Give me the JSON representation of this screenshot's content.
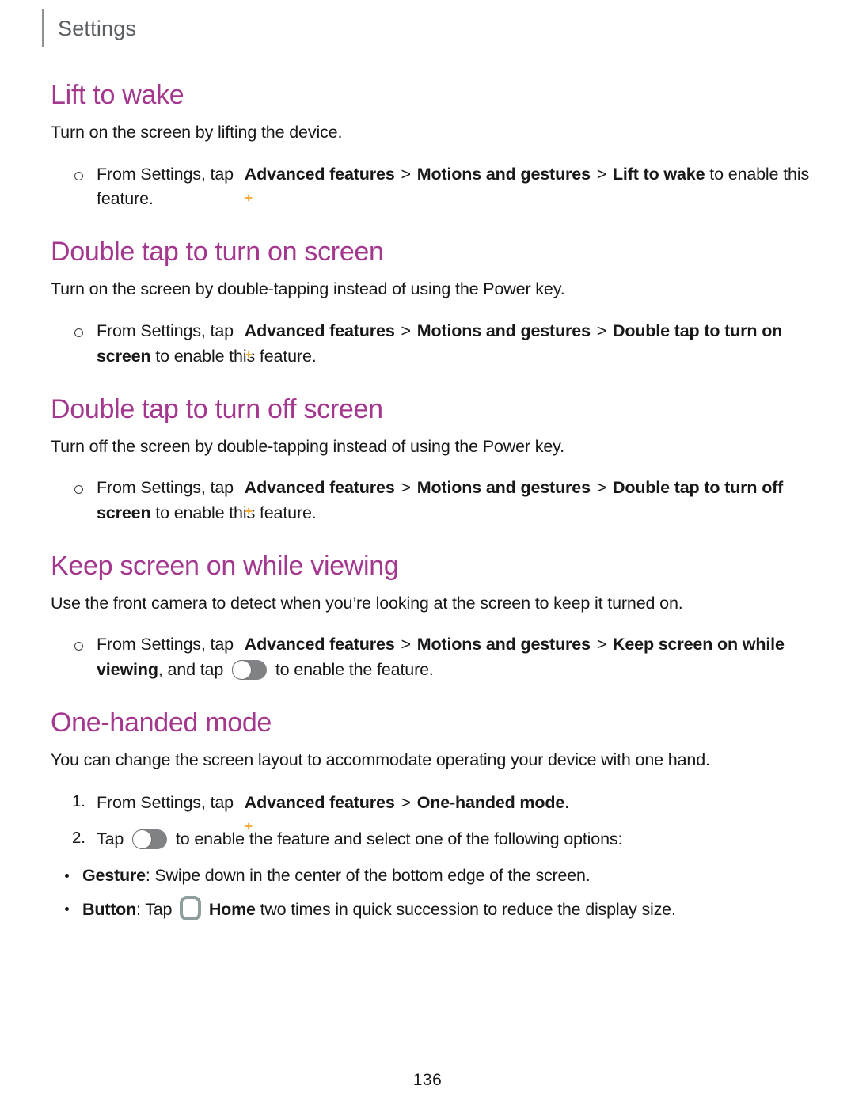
{
  "header": {
    "title": "Settings"
  },
  "icons": {
    "advanced_features": "advanced-features-icon",
    "toggle_off": "toggle-switch-off-icon",
    "home_button": "home-button-icon"
  },
  "colors": {
    "heading": "#a4378e",
    "body": "#17181a",
    "header_text": "#5a5f64",
    "icon_amber": "#f6ad3c",
    "toggle_track": "#808285",
    "home_outline": "#8d9e9c"
  },
  "sections": [
    {
      "title": "Lift to wake",
      "intro": "Turn on the screen by lifting the device.",
      "steps": [
        {
          "lead": "From Settings, tap",
          "icon": "advanced-features-icon",
          "path": [
            "Advanced features",
            "Motions and gestures",
            "Lift to wake"
          ],
          "tail": "to enable this feature."
        }
      ]
    },
    {
      "title": "Double tap to turn on screen",
      "intro": "Turn on the screen by double-tapping instead of using the Power key.",
      "steps": [
        {
          "lead": "From Settings, tap",
          "icon": "advanced-features-icon",
          "path": [
            "Advanced features",
            "Motions and gestures",
            "Double tap to turn on screen"
          ],
          "tail": "to enable this feature."
        }
      ]
    },
    {
      "title": "Double tap to turn off screen",
      "intro": "Turn off the screen by double-tapping instead of using the Power key.",
      "steps": [
        {
          "lead": "From Settings, tap",
          "icon": "advanced-features-icon",
          "path": [
            "Advanced features",
            "Motions and gestures",
            "Double tap to turn off screen"
          ],
          "tail": "to enable this feature."
        }
      ]
    },
    {
      "title": "Keep screen on while viewing",
      "intro": "Use the front camera to detect when you’re looking at the screen to keep it turned on.",
      "steps": [
        {
          "lead": "From Settings, tap",
          "icon": "advanced-features-icon",
          "path": [
            "Advanced features",
            "Motions and gestures",
            "Keep screen on while viewing"
          ],
          "tail_before_toggle": ", and tap",
          "tail": "to enable the feature."
        }
      ]
    },
    {
      "title": "One-handed mode",
      "intro": "You can change the screen layout to accommodate operating your device with one hand.",
      "numbered_steps": [
        {
          "lead": "From Settings, tap",
          "icon": "advanced-features-icon",
          "path": [
            "Advanced features",
            "One-handed mode"
          ],
          "tail": "."
        },
        {
          "lead": "Tap",
          "icon": "toggle-switch-off-icon",
          "tail": "to enable the feature and select one of the following options:"
        }
      ],
      "options": [
        {
          "label": "Gesture",
          "text": ": Swipe down in the center of the bottom edge of the screen."
        },
        {
          "label": "Button",
          "text_before": ": Tap",
          "icon": "home-button-icon",
          "bold_word": "Home",
          "text_after": "two times in quick succession to reduce the display size."
        }
      ]
    }
  ],
  "footer": {
    "page_number": "136"
  }
}
